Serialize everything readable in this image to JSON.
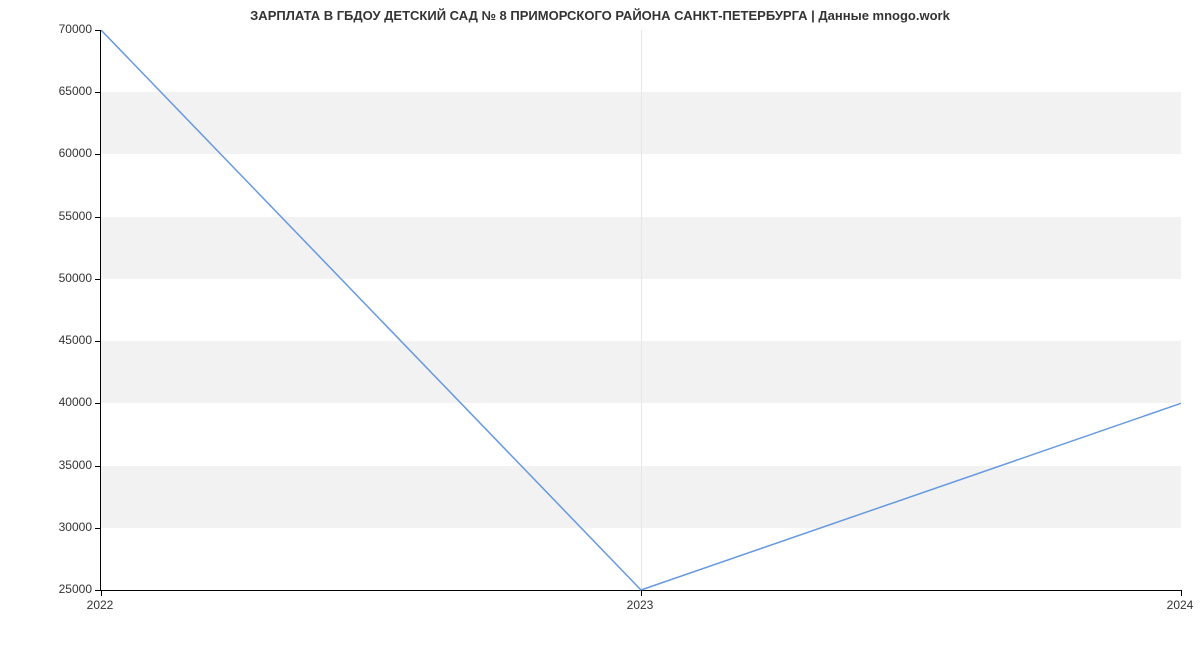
{
  "chart_data": {
    "type": "line",
    "title": "ЗАРПЛАТА В ГБДОУ ДЕТСКИЙ САД № 8 ПРИМОРСКОГО РАЙОНА САНКТ-ПЕТЕРБУРГА | Данные mnogo.work",
    "x_categories": [
      "2022",
      "2023",
      "2024"
    ],
    "series": [
      {
        "name": "salary",
        "values": [
          70000,
          25000,
          40000
        ],
        "color": "#6699e0"
      }
    ],
    "y_ticks": [
      25000,
      30000,
      35000,
      40000,
      45000,
      50000,
      55000,
      60000,
      65000,
      70000
    ],
    "ylim": [
      25000,
      70000
    ],
    "xlabel": "",
    "ylabel": ""
  }
}
